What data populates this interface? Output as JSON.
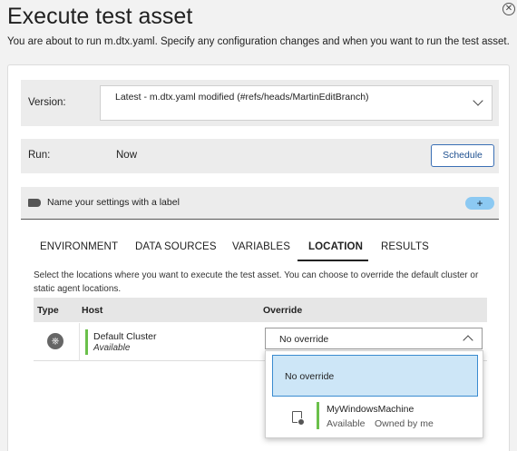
{
  "dialog": {
    "title": "Execute test asset",
    "subtitle": "You are about to run m.dtx.yaml. Specify any configuration changes and when you want to run the test asset."
  },
  "version": {
    "label": "Version:",
    "value": "Latest - m.dtx.yaml modified (#refs/heads/MartinEditBranch)"
  },
  "run": {
    "label": "Run:",
    "value": "Now",
    "schedule_label": "Schedule"
  },
  "label_row": {
    "placeholder": "Name your settings with a label",
    "add_label": "+"
  },
  "tabs": [
    {
      "label": "ENVIRONMENT",
      "active": false
    },
    {
      "label": "DATA SOURCES",
      "active": false
    },
    {
      "label": "VARIABLES",
      "active": false
    },
    {
      "label": "LOCATION",
      "active": true
    },
    {
      "label": "RESULTS",
      "active": false
    }
  ],
  "location": {
    "description": "Select the locations where you want to execute the test asset. You can choose to override the default cluster or static agent locations.",
    "columns": {
      "type": "Type",
      "host": "Host",
      "override": "Override"
    },
    "rows": [
      {
        "type_icon": "kubernetes-icon",
        "host": "Default Cluster",
        "status": "Available",
        "override": "No override"
      }
    ]
  },
  "override_dropdown": {
    "options": [
      {
        "label": "No override",
        "selected": true
      },
      {
        "icon": "agent-machine-icon",
        "name": "MyWindowsMachine",
        "status": "Available",
        "owner": "Owned by me"
      }
    ]
  },
  "colors": {
    "accent": "#3a6fb5",
    "available_green": "#6bc04b",
    "selected_bg": "#cde6f7",
    "add_button": "#8cc9f2"
  }
}
